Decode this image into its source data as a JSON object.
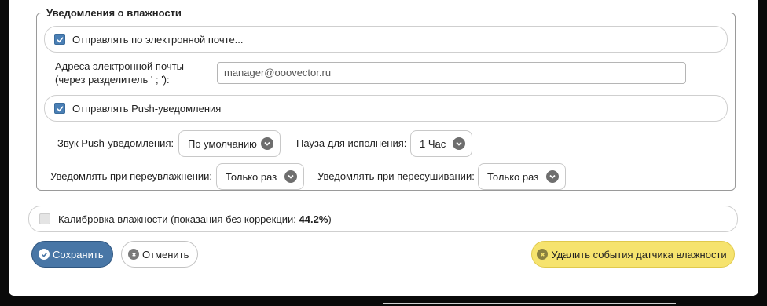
{
  "humidity_notifications": {
    "legend": "Уведомления о влажности",
    "email_checkbox_label": "Отправлять по электронной почте...",
    "email_checked": true,
    "email_field_label_line1": "Адреса электронной почты",
    "email_field_label_line2": "(через разделитель ' ; '):",
    "email_value": "manager@ooovector.ru",
    "push_checkbox_label": "Отправлять Push-уведомления",
    "push_checked": true,
    "push_sound_label": "Звук Push-уведомления:",
    "push_sound_value": "По умолчанию",
    "pause_label": "Пауза для исполнения:",
    "pause_value": "1 Час",
    "overwet_label": "Уведомлять при переувлажнении:",
    "overwet_value": "Только раз",
    "overdry_label": "Уведомлять при пересушивании:",
    "overdry_value": "Только раз"
  },
  "calibration": {
    "label": "Калибровка влажности (показания без коррекции:",
    "value": "44.2%",
    "suffix": ")",
    "checked": false
  },
  "actions": {
    "save_label": "Сохранить",
    "cancel_label": "Отменить",
    "delete_label": "Удалить события датчика влажности"
  },
  "colors": {
    "accent": "#4876a6",
    "checkbox": "#4a7fb5",
    "warning": "#f6e36e"
  }
}
